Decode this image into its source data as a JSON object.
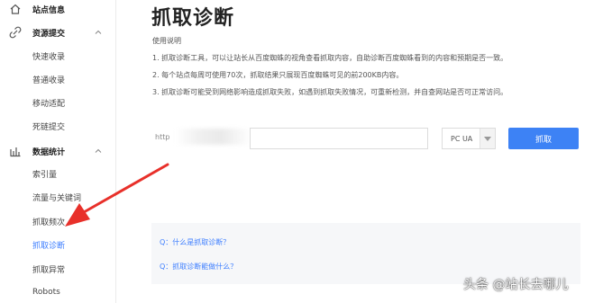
{
  "sidebar": {
    "site_info": "站点信息",
    "resource_submit": {
      "label": "资源提交",
      "items": [
        "快速收录",
        "普通收录",
        "移动适配",
        "死链提交"
      ]
    },
    "data_stats": {
      "label": "数据统计",
      "items": [
        "索引量",
        "流量与关键词",
        "抓取频次",
        "抓取诊断",
        "抓取异常",
        "Robots"
      ]
    },
    "active_item": "抓取诊断"
  },
  "main": {
    "title": "抓取诊断",
    "usage_title": "使用说明",
    "notes": [
      "1. 抓取诊断工具，可以让站长从百度蜘蛛的视角查看抓取内容，自助诊断百度蜘蛛看到的内容和预期是否一致。",
      "2. 每个站点每周可使用70次，抓取结果只展现百度蜘蛛可见的前200KB内容。",
      "3. 抓取诊断可能受到网络影响造成抓取失败，如遇到抓取失败情况，可重新检测，并自查网站是否可正常访问。"
    ],
    "url_prefix": "http",
    "url_value": "",
    "ua_select": "PC UA",
    "fetch_button": "抓取",
    "faq": [
      "Q：什么是抓取诊断？",
      "Q：抓取诊断能做什么？"
    ]
  },
  "watermark": "头条 @站长去哪儿",
  "colors": {
    "accent": "#3d82f5",
    "link": "#3d7eff",
    "arrow": "#e8302a"
  }
}
